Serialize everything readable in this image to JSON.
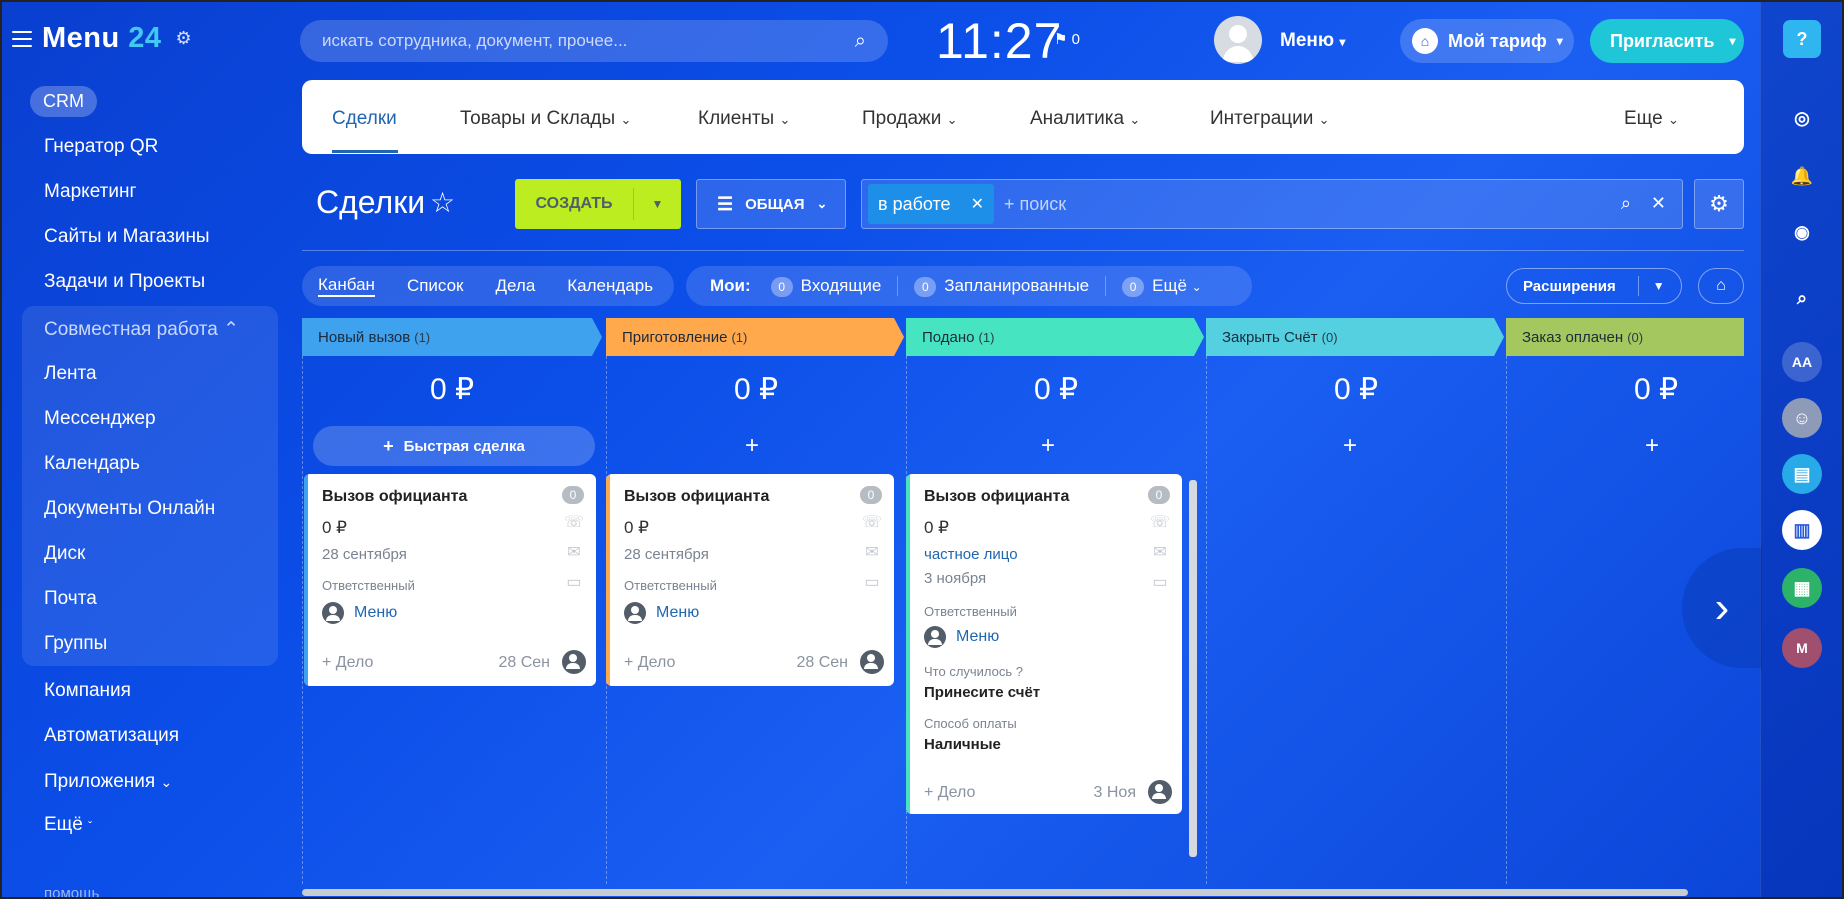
{
  "app": {
    "logo_text": "Menu",
    "logo_num": "24"
  },
  "sidebar": {
    "crm": "CRM",
    "items_top": [
      "Гнератор QR",
      "Маркетинг",
      "Сайты и Магазины",
      "Задачи и Проекты"
    ],
    "group_title": "Совместная работа",
    "group_items": [
      "Лента",
      "Мессенджер",
      "Календарь",
      "Документы Онлайн",
      "Диск",
      "Почта",
      "Группы"
    ],
    "items_bottom": [
      "Компания",
      "Автоматизация",
      "Приложения",
      "Ещё"
    ],
    "footer": "помощь"
  },
  "topbar": {
    "search_placeholder": "искать сотрудника, документ, прочее...",
    "clock": "11:27",
    "flag_count": "0",
    "user_name": "Меню",
    "tariff": "Мой тариф",
    "invite": "Пригласить"
  },
  "rail": {
    "help": "?",
    "aa": "AA",
    "m": "M"
  },
  "tabs": [
    "Сделки",
    "Товары и Склады",
    "Клиенты",
    "Продажи",
    "Аналитика",
    "Интеграции",
    "Еще"
  ],
  "toolbar": {
    "title": "Сделки",
    "create": "СОЗДАТЬ",
    "filter": "ОБЩАЯ",
    "chip": "в работе",
    "search_placeholder": "+ поиск"
  },
  "views": [
    "Канбан",
    "Список",
    "Дела",
    "Календарь"
  ],
  "my": {
    "label": "Мои:",
    "items": [
      {
        "count": "0",
        "label": "Входящие"
      },
      {
        "count": "0",
        "label": "Запланированные"
      },
      {
        "count": "0",
        "label": "Ещё"
      }
    ]
  },
  "extensions": "Расширения",
  "colors": {
    "new": "#3fa2ee",
    "prep": "#ffa84c",
    "served": "#47e4c2",
    "close": "#55d0e0",
    "paid": "#a5c75f",
    "create": "#bbed21",
    "invite": "#1ec6d8"
  },
  "columns": [
    {
      "name": "Новый вызов",
      "count": "(1)",
      "sum": "0 ₽"
    },
    {
      "name": "Приготовление",
      "count": "(1)",
      "sum": "0 ₽"
    },
    {
      "name": "Подано",
      "count": "(1)",
      "sum": "0 ₽"
    },
    {
      "name": "Закрыть Счёт",
      "count": "(0)",
      "sum": "0 ₽"
    },
    {
      "name": "Заказ оплачен",
      "count": "(0)",
      "sum": "0 ₽"
    }
  ],
  "quick_deal": "Быстрая сделка",
  "plus": "+",
  "cards": [
    {
      "title": "Вызов официанта",
      "badge": "0",
      "sum": "0 ₽",
      "date": "28 сентября",
      "resp_label": "Ответственный",
      "resp": "Меню",
      "add": "+ Дело",
      "short_date": "28 Сен"
    },
    {
      "title": "Вызов официанта",
      "badge": "0",
      "sum": "0 ₽",
      "date": "28 сентября",
      "resp_label": "Ответственный",
      "resp": "Меню",
      "add": "+ Дело",
      "short_date": "28 Сен"
    },
    {
      "title": "Вызов официанта",
      "badge": "0",
      "sum": "0 ₽",
      "client": "частное лицо",
      "date": "3 ноября",
      "resp_label": "Ответственный",
      "resp": "Меню",
      "field1_label": "Что случилось ?",
      "field1_value": "Принесите счёт",
      "field2_label": "Способ оплаты",
      "field2_value": "Наличные",
      "add": "+ Дело",
      "short_date": "3 Ноя"
    }
  ]
}
